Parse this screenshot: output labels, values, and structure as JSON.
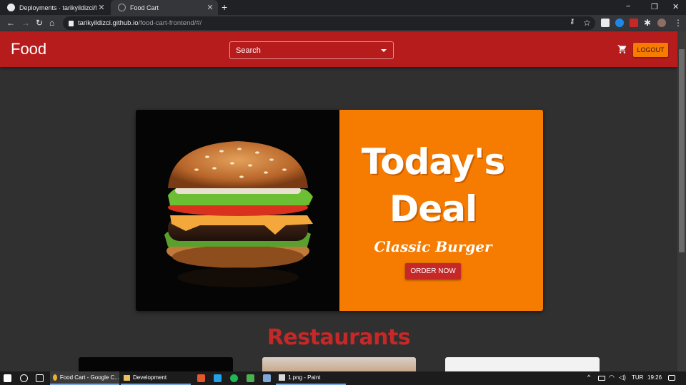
{
  "browser": {
    "tabs": [
      {
        "title": "Deployments · tarikyildizci/food-",
        "close": "✕"
      },
      {
        "title": "Food Cart",
        "close": "✕"
      }
    ],
    "new_tab": "+",
    "window_controls": {
      "minimize": "−",
      "restore": "❐",
      "close": "✕"
    },
    "url_host": "tarikyildizci.github.io",
    "url_path": "/food-cart-frontend/#/"
  },
  "app": {
    "logo": "Food",
    "search_label": "Search",
    "logout_label": "LOGOUT"
  },
  "deal": {
    "title_line1": "Today's",
    "title_line2": "Deal",
    "subtitle": "Classic Burger",
    "order_label": "ORDER NOW"
  },
  "restaurants": {
    "heading": "Restaurants"
  },
  "taskbar": {
    "items": [
      {
        "label": "Food Cart - Google C..."
      },
      {
        "label": "Development"
      },
      {
        "label": "1.png - Paint"
      }
    ],
    "language": "TUR",
    "time": "19:26"
  },
  "colors": {
    "appbar": "#b71c1c",
    "accent_orange": "#f57c00",
    "order_button": "#c62828",
    "background": "#303030"
  }
}
